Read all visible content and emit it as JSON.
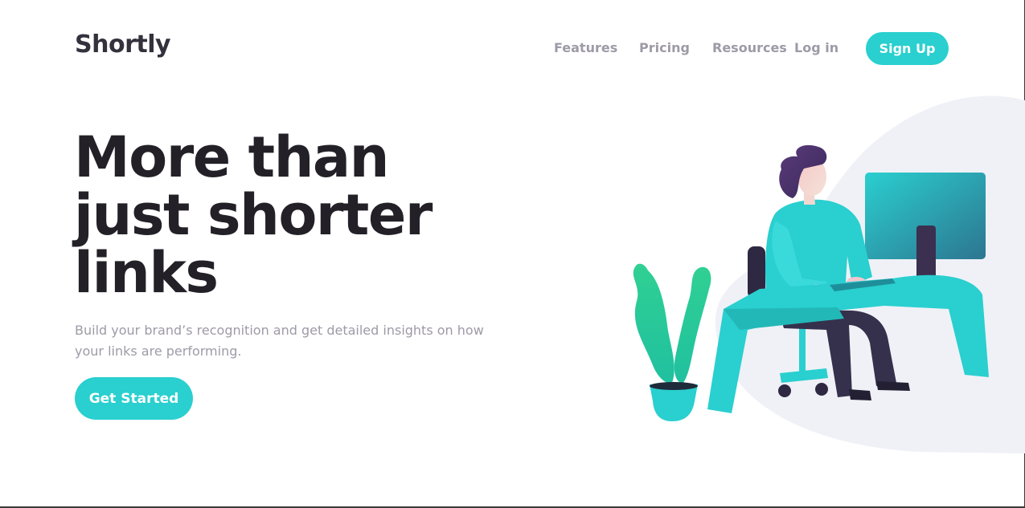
{
  "brand": {
    "name": "Shortly"
  },
  "nav": {
    "links": [
      {
        "label": "Features"
      },
      {
        "label": "Pricing"
      },
      {
        "label": "Resources"
      }
    ],
    "login_label": "Log in",
    "signup_label": "Sign Up"
  },
  "hero": {
    "title_lines": [
      "More than",
      "just shorter",
      "links"
    ],
    "description": "Build your brand’s recognition and get detailed insights on how your links are performing.",
    "cta_label": "Get Started"
  },
  "colors": {
    "accent": "#2acfcf",
    "heading": "#232127",
    "muted": "#9e9aa7",
    "illustration_bg": "#eff1f7"
  }
}
